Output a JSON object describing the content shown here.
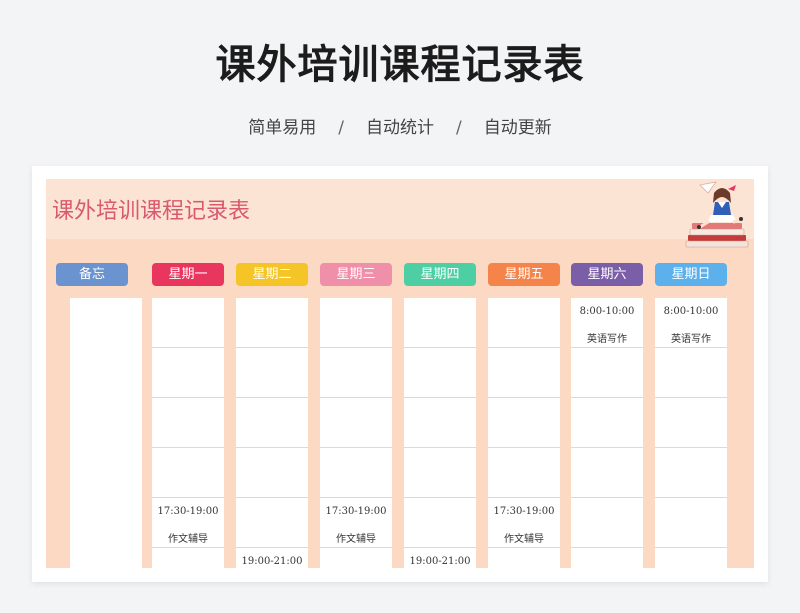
{
  "header": {
    "title": "课外培训课程记录表",
    "features": [
      "简单易用",
      "自动统计",
      "自动更新"
    ],
    "separator": "/"
  },
  "sheet": {
    "banner_title": "课外培训课程记录表",
    "columns": [
      {
        "label": "备忘",
        "color": "#6b93cf"
      },
      {
        "label": "星期一",
        "color": "#e8365e"
      },
      {
        "label": "星期二",
        "color": "#f5c528"
      },
      {
        "label": "星期三",
        "color": "#f08fa9"
      },
      {
        "label": "星期四",
        "color": "#4ecfa3"
      },
      {
        "label": "星期五",
        "color": "#f5844a"
      },
      {
        "label": "星期六",
        "color": "#7b5ea8"
      },
      {
        "label": "星期日",
        "color": "#5cb0ec"
      }
    ],
    "entries": {
      "monday": [
        {
          "row": 4,
          "time": "17:30-19:00",
          "subject": "作文辅导"
        }
      ],
      "tuesday": [
        {
          "row": 5,
          "time": "19:00-21:00",
          "subject": ""
        }
      ],
      "wednesday": [
        {
          "row": 4,
          "time": "17:30-19:00",
          "subject": "作文辅导"
        }
      ],
      "thursday": [
        {
          "row": 5,
          "time": "19:00-21:00",
          "subject": ""
        }
      ],
      "friday": [
        {
          "row": 4,
          "time": "17:30-19:00",
          "subject": "作文辅导"
        }
      ],
      "saturday": [
        {
          "row": 0,
          "time": "8:00-10:00",
          "subject": "英语写作"
        }
      ],
      "sunday": [
        {
          "row": 0,
          "time": "8:00-10:00",
          "subject": "英语写作"
        }
      ]
    },
    "icons": {
      "illustration": "girl-reading-books-illustration"
    }
  }
}
